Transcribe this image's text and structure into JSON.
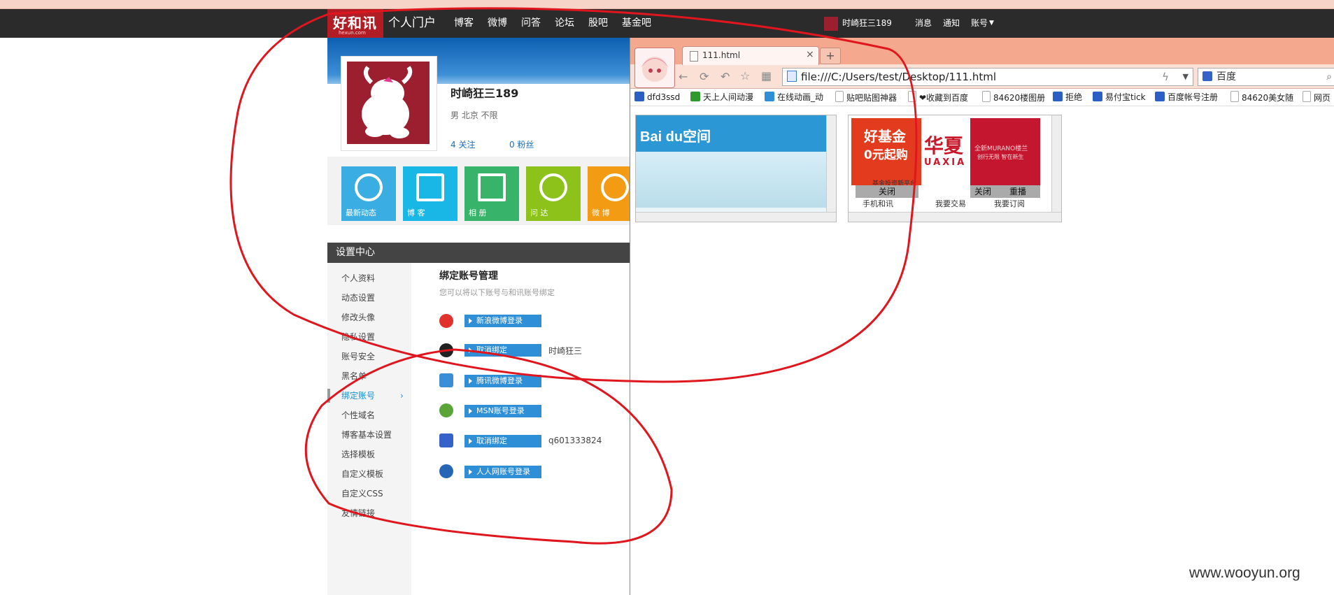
{
  "top_strip": [
    "",
    "",
    "",
    "",
    "",
    "",
    ""
  ],
  "site": {
    "logo_text": "好和讯",
    "logo_sub": "hexun.com",
    "nav": [
      "个人门户",
      "博客",
      "微博",
      "问答",
      "论坛",
      "股吧",
      "基金吧"
    ],
    "user_name": "时崎狂三189",
    "right_links": [
      "消息",
      "通知",
      "账号"
    ]
  },
  "profile": {
    "name": "时崎狂三189",
    "meta": "男  北京  不限",
    "follow_count": "4",
    "follow_label": "关注",
    "fans_count": "0",
    "fans_label": "粉丝"
  },
  "tiles": [
    {
      "label": "最新动态",
      "color": "#3aaee3"
    },
    {
      "label": "博 客",
      "color": "#19b7e6"
    },
    {
      "label": "相 册",
      "color": "#37b46a"
    },
    {
      "label": "问 达",
      "color": "#8cc21a"
    },
    {
      "label": "微 博",
      "color": "#f39b13"
    }
  ],
  "settings": {
    "title": "设置中心",
    "sidebar": [
      "个人资料",
      "动态设置",
      "修改头像",
      "隐私设置",
      "账号安全",
      "黑名单",
      "绑定账号",
      "个性域名",
      "博客基本设置",
      "选择模板",
      "自定义模板",
      "自定义CSS",
      "友情链接"
    ],
    "active_index": 6,
    "section_title": "绑定账号管理",
    "section_sub": "您可以将以下账号与和讯账号绑定",
    "bindings": [
      {
        "icon": "weibo-icon",
        "button": "新浪微博登录",
        "account": "",
        "color": "#e0312c"
      },
      {
        "icon": "qq-icon",
        "button": "取消绑定",
        "account": "时崎狂三",
        "color": "#222222"
      },
      {
        "icon": "tencent-weibo-icon",
        "button": "腾讯微博登录",
        "account": "",
        "color": "#3a8ed6"
      },
      {
        "icon": "msn-icon",
        "button": "MSN账号登录",
        "account": "",
        "color": "#5aa43a"
      },
      {
        "icon": "baidu-icon",
        "button": "取消绑定",
        "account": "q601333824",
        "color": "#3561c9"
      },
      {
        "icon": "renren-icon",
        "button": "人人网账号登录",
        "account": "",
        "color": "#2866b5"
      }
    ]
  },
  "browser": {
    "tab_title": "111.html",
    "new_tab": "+",
    "address": "file:///C:/Users/test/Desktop/111.html",
    "search_engine": "百度",
    "bookmarks": [
      {
        "label": "dfd3ssd",
        "color": "#2b5fc3"
      },
      {
        "label": "天上人间动漫",
        "color": "#2e9a2e"
      },
      {
        "label": "在线动画_动",
        "color": "#2d8fd6"
      },
      {
        "label": "贴吧贴图神器",
        "color": "#dddddd"
      },
      {
        "label": "❤收藏到百度",
        "color": "#dddddd"
      },
      {
        "label": "84620楼图册",
        "color": "#dddddd"
      },
      {
        "label": "拒绝",
        "color": "#2b5fc3"
      },
      {
        "label": "易付宝tick",
        "color": "#2b5fc3"
      },
      {
        "label": "百度帐号注册",
        "color": "#2b5fc3"
      },
      {
        "label": "84620美女随",
        "color": "#dddddd"
      },
      {
        "label": "网页",
        "color": "#dddddd"
      }
    ],
    "frame1": {
      "brand": "Bai du空间"
    },
    "frame2": {
      "ad1_line1": "好基金",
      "ad1_line2": "0元起购",
      "ad1_line3": "基金投资新平台",
      "ad2": "华夏",
      "ad2_sub": "UAXIA",
      "ad3_line1": "全新MURANO楼兰",
      "ad3_line2": "创行无限  智在新生",
      "close1": "关闭",
      "close2": "关闭",
      "replay": "重播",
      "bottom1": "手机和讯",
      "bottom2": "我要交易",
      "bottom3": "我要订阅"
    }
  },
  "watermark": "www.wooyun.org"
}
